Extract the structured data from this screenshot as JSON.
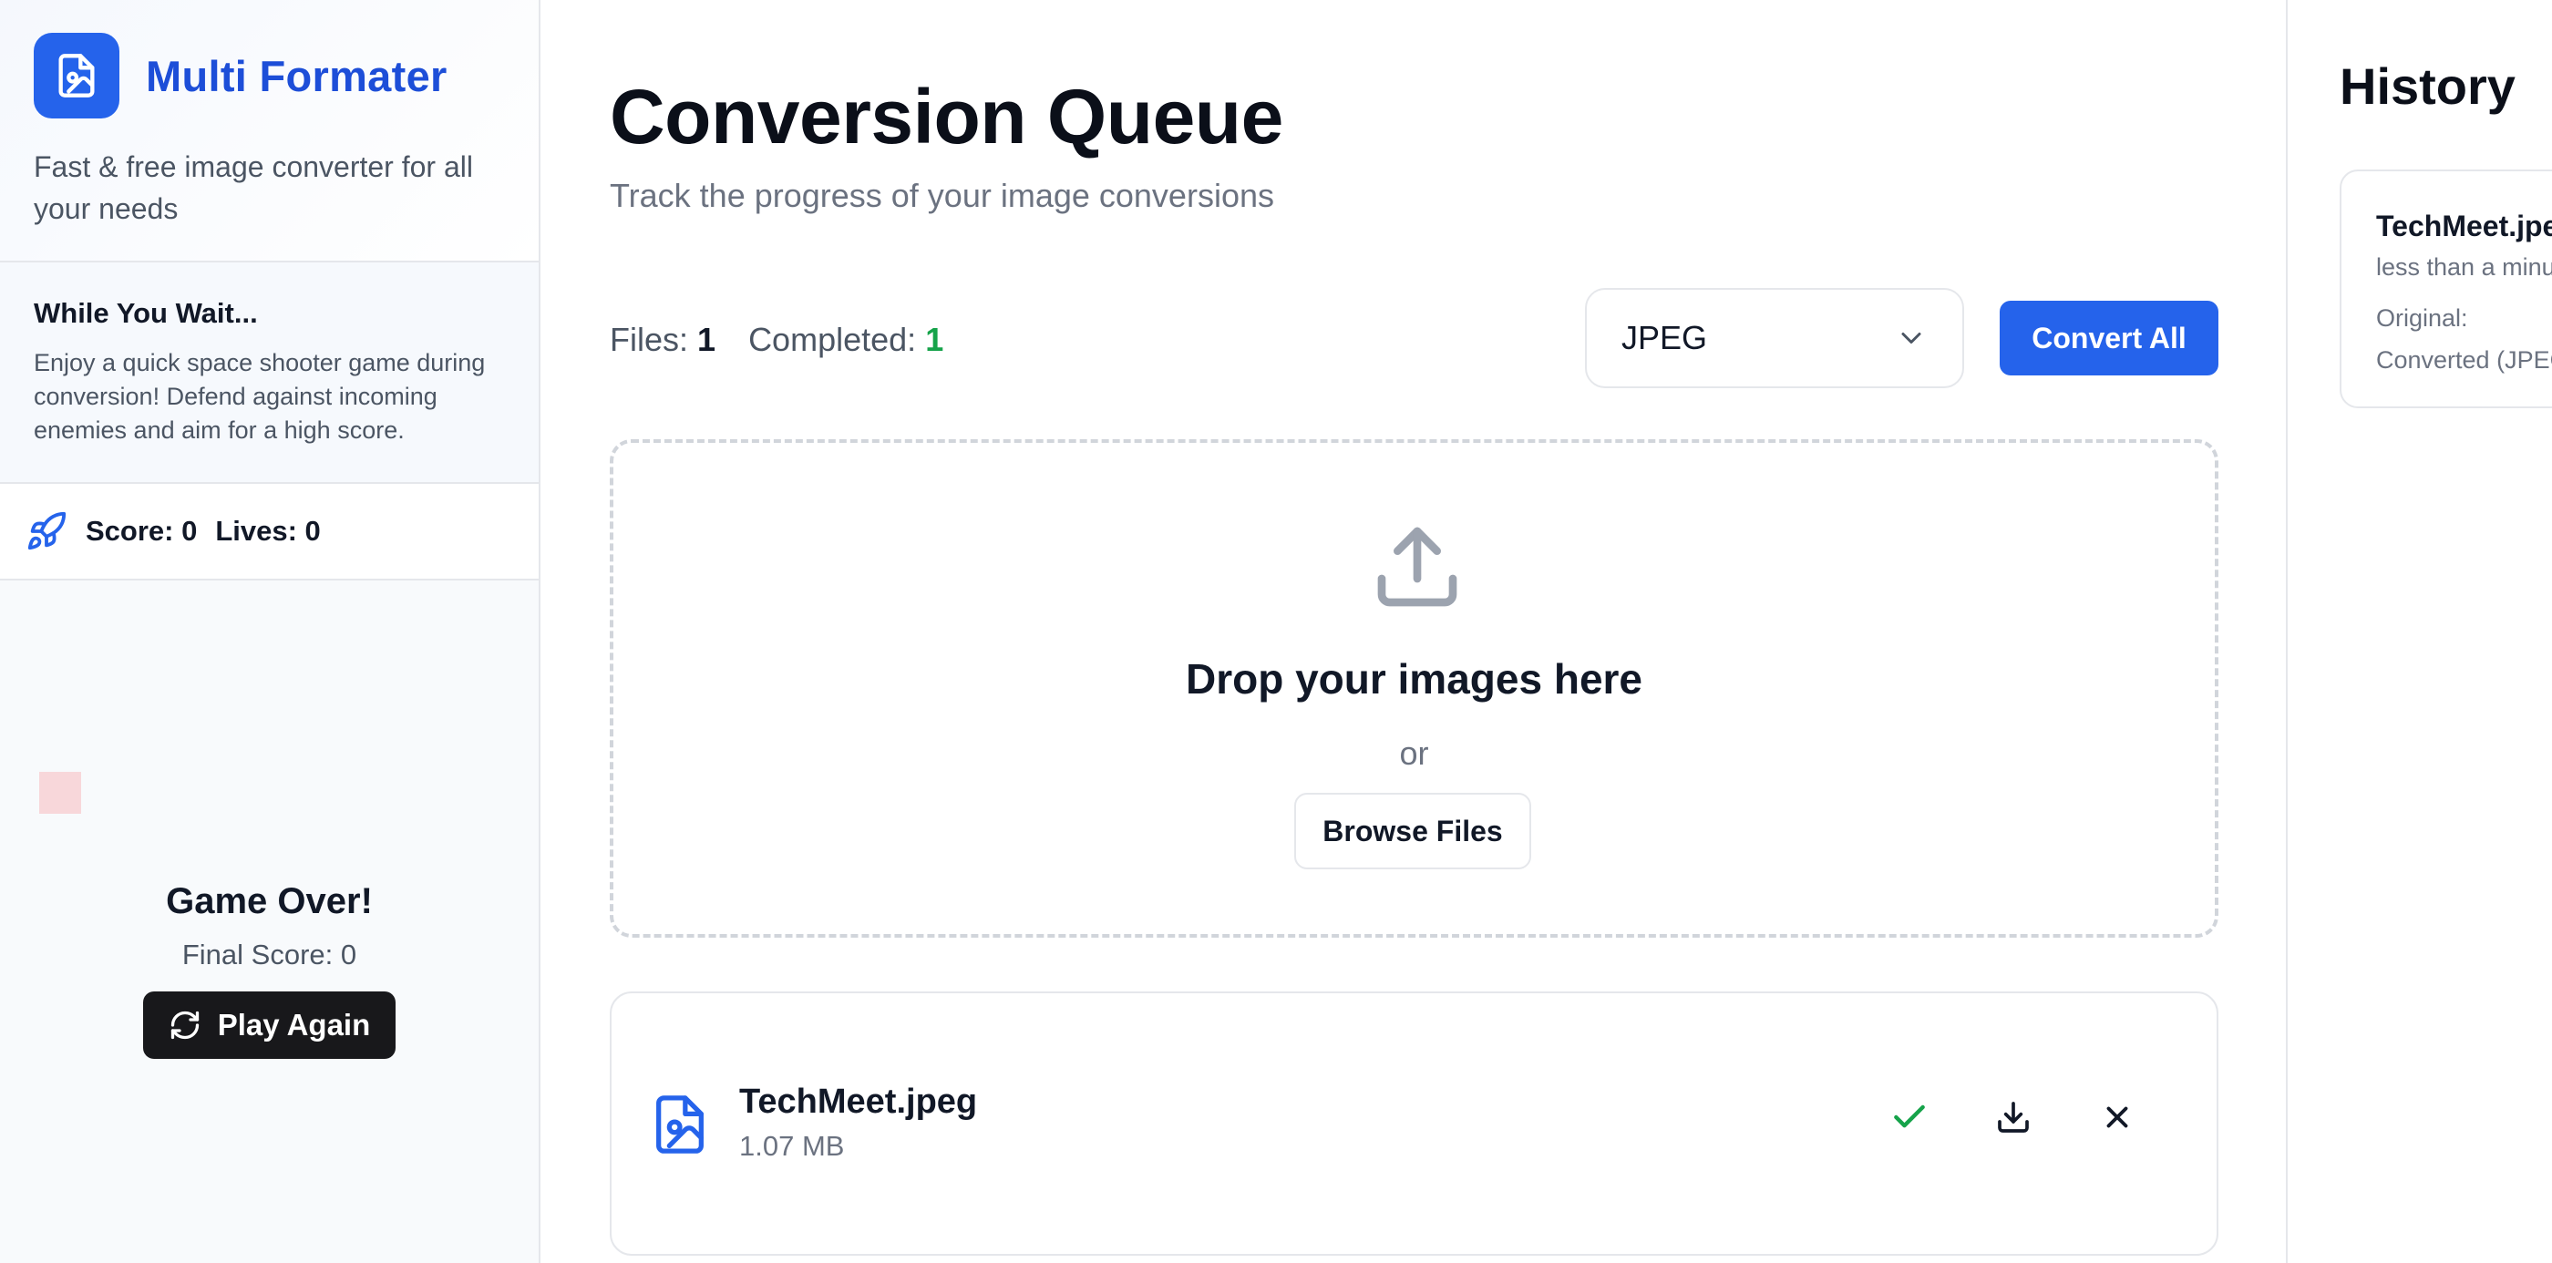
{
  "sidebar": {
    "brand_name": "Multi Formater",
    "tagline": "Fast & free image converter for all your needs",
    "wait_title": "While You Wait...",
    "wait_text": "Enjoy a quick space shooter game during conversion! Defend against incoming enemies and aim for a high score.",
    "score_label": "Score: 0",
    "lives_label": "Lives: 0",
    "game_over_title": "Game Over!",
    "final_score": "Final Score: 0",
    "play_again_label": "Play Again"
  },
  "main": {
    "title": "Conversion Queue",
    "subtitle": "Track the progress of your image conversions",
    "files_label": "Files:",
    "files_count": "1",
    "completed_label": "Completed:",
    "completed_count": "1",
    "format_selected": "JPEG",
    "convert_all_label": "Convert All",
    "drop_title": "Drop your images here",
    "drop_or": "or",
    "browse_label": "Browse Files",
    "file": {
      "name": "TechMeet.jpeg",
      "size": "1.07 MB"
    }
  },
  "history": {
    "title": "History",
    "item": {
      "name": "TechMeet.jpeg",
      "time": "less than a minute ago",
      "original_label": "Original:",
      "converted_label": "Converted (JPEG):"
    }
  },
  "colors": {
    "accent": "#2563eb",
    "brand_text": "#1d4ed8",
    "success": "#16a34a",
    "dark_button": "#18181b"
  },
  "icons": {
    "logo": "image-file-icon",
    "score": "rocket-icon",
    "play_again": "refresh-icon",
    "format": "chevron-down-icon",
    "upload": "upload-icon",
    "file": "image-file-icon",
    "status": "check-icon",
    "download": "download-icon",
    "remove": "close-icon"
  }
}
